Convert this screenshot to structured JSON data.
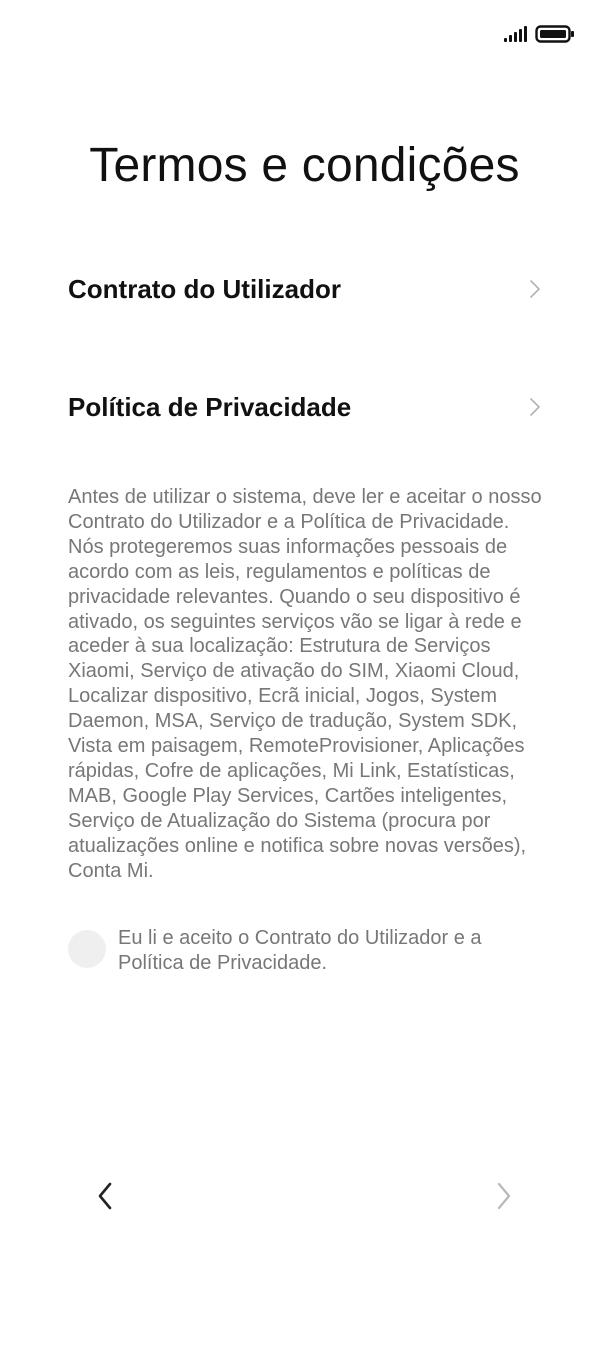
{
  "status_bar": {
    "icons": [
      "signal-icon",
      "battery-icon"
    ]
  },
  "title": "Termos e condições",
  "menu": [
    {
      "label": "Contrato do Utilizador",
      "icon": "chevron-right-icon"
    },
    {
      "label": "Política de Privacidade",
      "icon": "chevron-right-icon"
    }
  ],
  "description": "Antes de utilizar o sistema, deve ler e aceitar o nosso Contrato do Utilizador e a Política de Privacidade. Nós protegeremos suas informações pessoais de acordo com as leis, regulamentos e políticas de privacidade relevantes. Quando o seu dispositivo é ativado, os seguintes serviços vão se ligar à rede e aceder à sua localização: Estrutura de Serviços Xiaomi, Serviço de ativação do SIM, Xiaomi Cloud, Localizar dispositivo, Ecrã inicial, Jogos, System Daemon, MSA, Serviço de tradução, System SDK, Vista em paisagem, RemoteProvisioner, Aplicações rápidas, Cofre de aplicações, Mi Link, Estatísticas, MAB, Google Play Services, Cartões inteligentes, Serviço de Atualização do Sistema (procura por atualizações online e notifica sobre novas versões), Conta Mi.",
  "consent": {
    "text": "Eu li e aceito o Contrato do Utilizador e a Política de Privacidade.",
    "checked": false
  },
  "navigation": {
    "back_icon": "chevron-left-icon",
    "next_icon": "chevron-right-icon"
  },
  "colors": {
    "text_primary": "#111111",
    "text_secondary": "#777777",
    "chevron_light": "#b3b3b3",
    "radio_fill": "#efefef",
    "background": "#ffffff"
  }
}
